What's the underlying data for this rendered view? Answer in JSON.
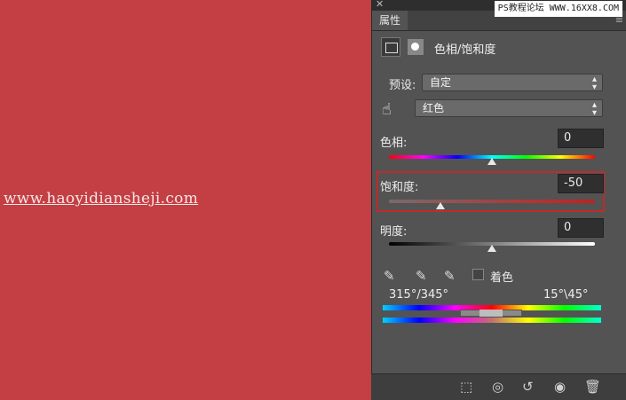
{
  "canvas": {
    "color": "#c43f44",
    "watermark": "www.haoyidiansheji.com"
  },
  "site_watermark": "PS教程论坛 WWW.16XX8.COM",
  "panel": {
    "tab_label": "属性",
    "title": "色相/饱和度",
    "preset_label": "预设:",
    "preset_value": "自定",
    "channel_value": "红色",
    "hue": {
      "label": "色相:",
      "value": "0",
      "level": 0.5
    },
    "saturation": {
      "label": "饱和度:",
      "value": "-50",
      "level": 0.25
    },
    "lightness": {
      "label": "明度:",
      "value": "0",
      "level": 0.5
    },
    "colorize_label": "着色",
    "range_left": "315°/345°",
    "range_right": "15°\\45°"
  },
  "icons": [
    "close-icon",
    "panel-menu-icon",
    "hue-saturation-icon",
    "mask-icon",
    "hand-targeted-adjustment-icon",
    "eyedropper-icon",
    "eyedropper-plus-icon",
    "eyedropper-minus-icon",
    "clip-to-layer-icon",
    "view-previous-icon",
    "reset-icon",
    "visibility-icon",
    "delete-icon"
  ],
  "colors": {
    "highlight": "#c02a2a",
    "panel_bg": "#535353"
  }
}
